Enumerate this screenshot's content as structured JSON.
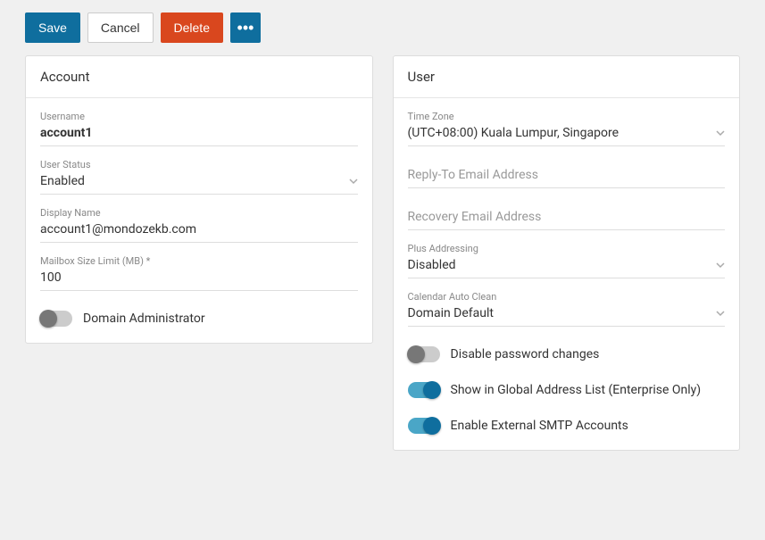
{
  "toolbar": {
    "save": "Save",
    "cancel": "Cancel",
    "delete": "Delete",
    "more": "•••"
  },
  "account": {
    "title": "Account",
    "username_label": "Username",
    "username_value": "account1",
    "user_status_label": "User Status",
    "user_status_value": "Enabled",
    "display_name_label": "Display Name",
    "display_name_value": "account1@mondozekb.com",
    "mailbox_limit_label": "Mailbox Size Limit (MB) *",
    "mailbox_limit_value": "100",
    "domain_admin_label": "Domain Administrator",
    "domain_admin_on": false
  },
  "user": {
    "title": "User",
    "timezone_label": "Time Zone",
    "timezone_value": "(UTC+08:00) Kuala Lumpur, Singapore",
    "reply_to_placeholder": "Reply-To Email Address",
    "recovery_placeholder": "Recovery Email Address",
    "plus_addressing_label": "Plus Addressing",
    "plus_addressing_value": "Disabled",
    "calendar_auto_clean_label": "Calendar Auto Clean",
    "calendar_auto_clean_value": "Domain Default",
    "disable_pw_label": "Disable password changes",
    "disable_pw_on": false,
    "show_gal_label": "Show in Global Address List (Enterprise Only)",
    "show_gal_on": true,
    "enable_smtp_label": "Enable External SMTP Accounts",
    "enable_smtp_on": true
  }
}
